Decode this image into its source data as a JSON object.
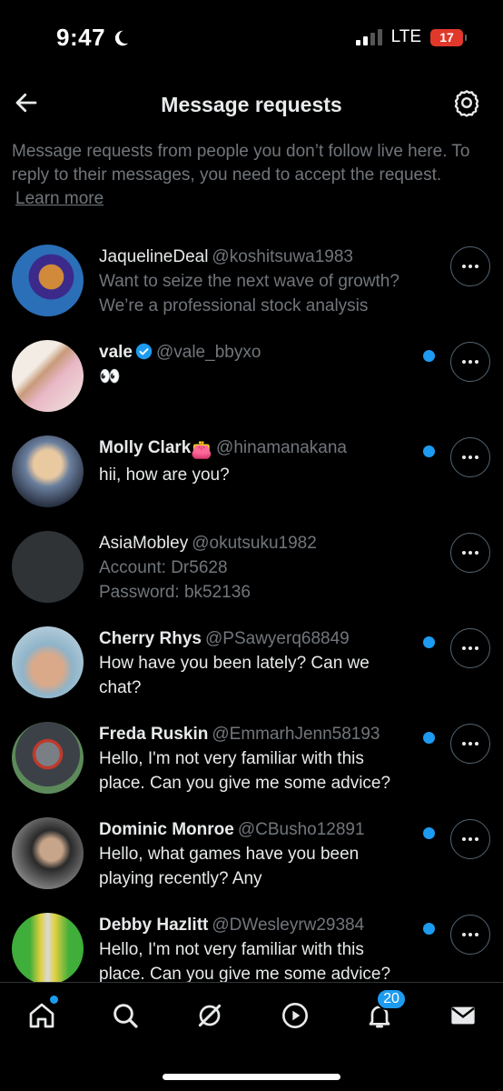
{
  "status": {
    "time": "9:47",
    "network": "LTE",
    "battery": "17"
  },
  "header": {
    "title": "Message requests"
  },
  "info": {
    "text": "Message requests from people you don’t follow live here. To reply to their messages, you need to accept the request.",
    "learn_more": "Learn more"
  },
  "requests": [
    {
      "name": "JaquelineDeal",
      "handle": "@koshitsuwa1983",
      "line1": "Want to seize the next wave of growth?",
      "line2": "We’re a professional stock analysis",
      "unread": false
    },
    {
      "name": "vale",
      "handle": "@vale_bbyxo",
      "line1": "👀",
      "line2": "",
      "unread": true,
      "verified": true
    },
    {
      "name": "Molly Clark",
      "handle": "@hinamanakana",
      "line1": "hii, how are you?",
      "line2": "",
      "unread": true,
      "name_emoji": "👛"
    },
    {
      "name": "AsiaMobley",
      "handle": "@okutsuku1982",
      "line1": "Account: Dr5628",
      "line2": "Password: bk52136",
      "unread": false
    },
    {
      "name": "Cherry Rhys",
      "handle": "@PSawyerq68849",
      "line1": "How have you been lately? Can we",
      "line2": "chat?",
      "unread": true
    },
    {
      "name": "Freda Ruskin",
      "handle": "@EmmarhJenn58193",
      "line1": "Hello, I'm not very familiar with this",
      "line2": "place. Can you give me some advice?",
      "unread": true
    },
    {
      "name": "Dominic Monroe",
      "handle": "@CBusho12891",
      "line1": "Hello, what games have you been",
      "line2": "playing recently? Any",
      "unread": true
    },
    {
      "name": "Debby Hazlitt",
      "handle": "@DWesleyrw29384",
      "line1": "Hello, I'm not very familiar with this",
      "line2": "place. Can you give me some advice?",
      "unread": true
    }
  ],
  "nav": {
    "icons": [
      "home-icon",
      "search-icon",
      "grok-icon",
      "play-icon",
      "bell-icon",
      "mail-icon"
    ],
    "notifications_count": "20"
  },
  "colors": {
    "accent": "#1d9bf0",
    "background": "#000000",
    "muted": "#71767b"
  }
}
